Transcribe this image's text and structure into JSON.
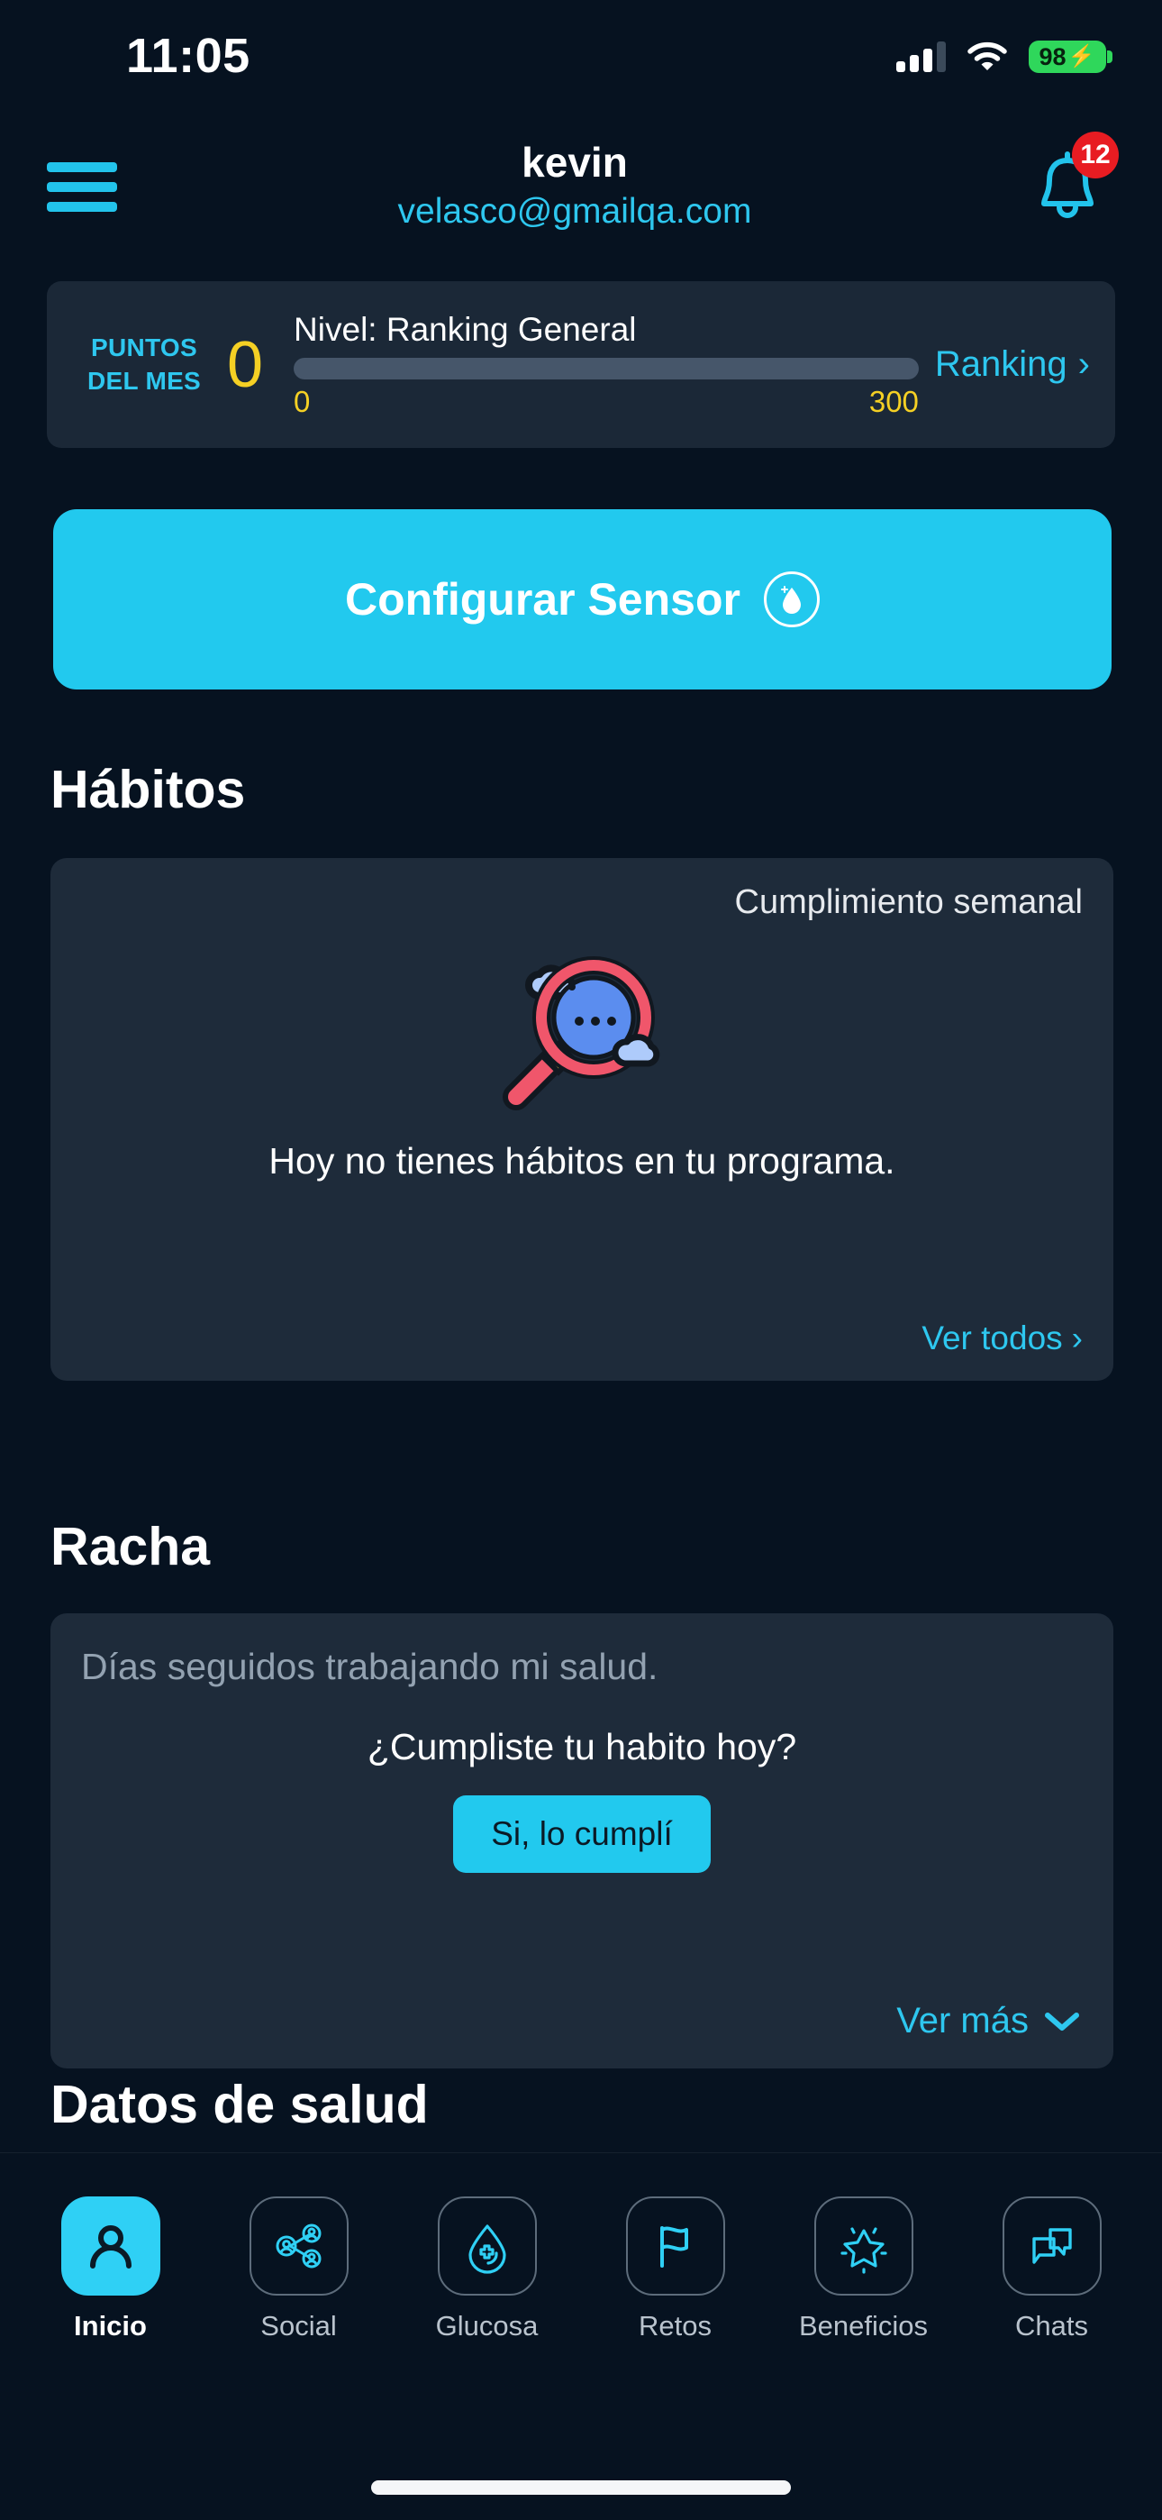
{
  "status_bar": {
    "time": "11:05",
    "battery_level": "98",
    "battery_charging_icon": "bolt-icon",
    "signal_icon": "cellular-signal-icon",
    "wifi_icon": "wifi-icon"
  },
  "header": {
    "menu_icon": "hamburger-menu-icon",
    "user_name": "kevin",
    "user_email": "velasco@gmailqa.com",
    "bell_icon": "notification-bell-icon",
    "notification_count": "12"
  },
  "points_card": {
    "points_label_line1": "PUNTOS",
    "points_label_line2": "DEL MES",
    "points_value": "0",
    "level_label": "Nivel: Ranking General",
    "progress_min": "0",
    "progress_max": "300",
    "progress_percent": 0,
    "ranking_link": "Ranking",
    "ranking_chevron": "chevron-right-icon"
  },
  "sensor_button": {
    "label": "Configurar Sensor",
    "icon": "droplet-circle-icon"
  },
  "habits_section": {
    "title": "Hábitos",
    "card_header": "Cumplimiento semanal",
    "illustration": "magnifying-glass-search-illustration",
    "empty_message": "Hoy no tienes hábitos en tu programa.",
    "view_all_link": "Ver todos",
    "view_all_chevron": "chevron-right-icon"
  },
  "streak_section": {
    "title": "Racha",
    "subtitle": "Días seguidos trabajando mi salud.",
    "question": "¿Cumpliste tu habito hoy?",
    "confirm_button": "Si, lo cumplí",
    "expand_link": "Ver más",
    "expand_chevron": "chevron-down-icon"
  },
  "health_section": {
    "title": "Datos de salud"
  },
  "bottom_nav": {
    "items": [
      {
        "label": "Inicio",
        "icon": "person-icon",
        "active": true
      },
      {
        "label": "Social",
        "icon": "network-people-icon",
        "active": false
      },
      {
        "label": "Glucosa",
        "icon": "droplet-cross-icon",
        "active": false
      },
      {
        "label": "Retos",
        "icon": "flag-icon",
        "active": false
      },
      {
        "label": "Beneficios",
        "icon": "sparkle-star-icon",
        "active": false
      },
      {
        "label": "Chats",
        "icon": "chat-bubbles-icon",
        "active": false
      }
    ]
  },
  "colors": {
    "page_background": "#061220",
    "card_background": "#1e2b3a",
    "accent_cyan": "#22c9ee",
    "accent_yellow": "#f5d024",
    "badge_red": "#e81c22",
    "battery_green": "#2fd75b"
  }
}
